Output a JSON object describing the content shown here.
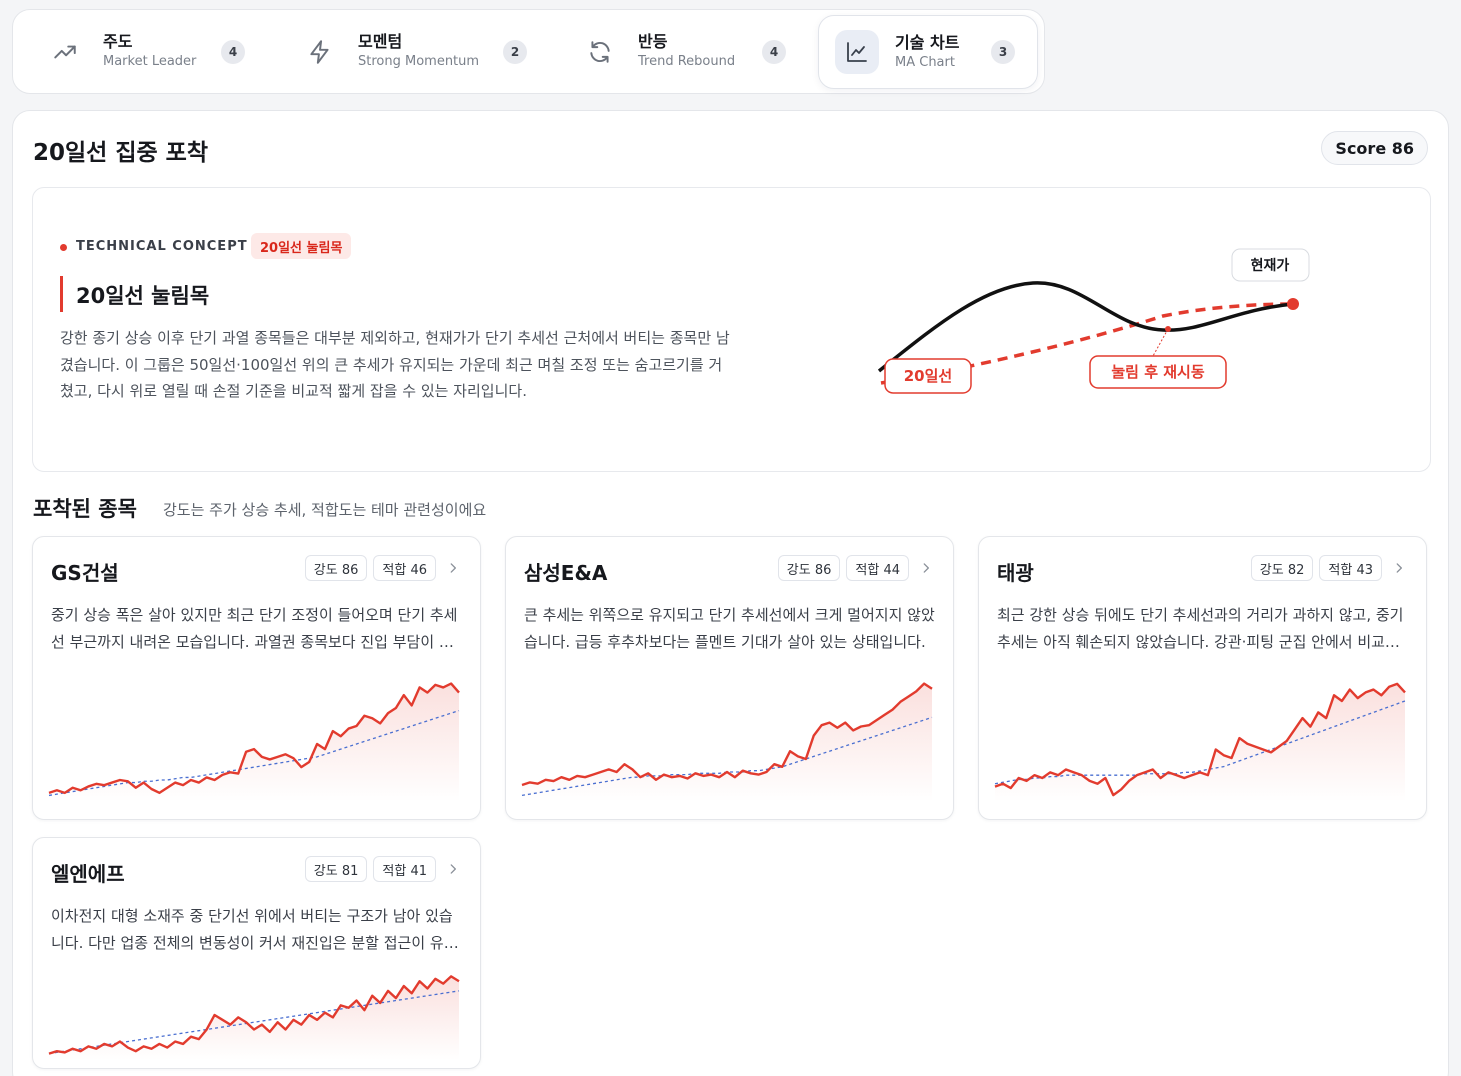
{
  "tabs": [
    {
      "title": "주도",
      "subtitle": "Market Leader",
      "count": "4",
      "icon": "trending-up-icon",
      "active": false
    },
    {
      "title": "모멘텀",
      "subtitle": "Strong Momentum",
      "count": "2",
      "icon": "lightning-icon",
      "active": false
    },
    {
      "title": "반등",
      "subtitle": "Trend Rebound",
      "count": "4",
      "icon": "refresh-icon",
      "active": false
    },
    {
      "title": "기술 차트",
      "subtitle": "MA Chart",
      "count": "3",
      "icon": "line-chart-icon",
      "active": true
    }
  ],
  "header": {
    "title": "20일선 집중 포착",
    "score": "Score 86"
  },
  "concept": {
    "tag": "TECHNICAL CONCEPT",
    "pill": "20일선 눌림목",
    "title": "20일선 눌림목",
    "description": "강한 종기 상승 이후 단기 과열 종목들은 대부분 제외하고, 현재가가 단기 추세선 근처에서 버티는 종목만 남겼습니다. 이 그룹은 50일선·100일선 위의 큰 추세가 유지되는 가운데 최근 며칠 조정 또는 숨고르기를 거쳤고, 다시 위로 열릴 때 손절 기준을 비교적 짧게 잡을 수 있는 자리입니다.",
    "diagram": {
      "price_label": "현재가",
      "ma_label": "20일선",
      "rebound_label": "눌림 후 재시동"
    }
  },
  "section": {
    "title": "포착된 종목",
    "subtitle": "강도는 주가 상승 추세, 적합도는 테마 관련성이에요"
  },
  "colors": {
    "accent": "#e23b2e",
    "ma_line": "#4a6fd1",
    "text": "#16181d"
  },
  "cards": [
    {
      "name": "GS건설",
      "strength": "강도 86",
      "fit": "적합 46",
      "description": "중기 상승 폭은 살아 있지만 최근 단기 조정이 들어오며 단기 추세선 부근까지 내려온 모습입니다. 과열권 종목보다 진입 부담이 상대적으로 적습니다.",
      "price": [
        10,
        12,
        10,
        14,
        12,
        15,
        17,
        16,
        18,
        20,
        19,
        14,
        18,
        13,
        10,
        14,
        18,
        16,
        20,
        18,
        22,
        20,
        24,
        26,
        25,
        42,
        44,
        38,
        36,
        38,
        40,
        37,
        30,
        34,
        48,
        44,
        58,
        54,
        60,
        62,
        70,
        68,
        64,
        72,
        76,
        86,
        78,
        92,
        88,
        94,
        92,
        95,
        88
      ],
      "ma": [
        8,
        9,
        10,
        11,
        12,
        13,
        14,
        15,
        16,
        17,
        18,
        18,
        19,
        19,
        20,
        20,
        21,
        22,
        22,
        23,
        24,
        25,
        26,
        27,
        28,
        29,
        30,
        31,
        32,
        33,
        34,
        35,
        36,
        37,
        38,
        40,
        42,
        44,
        46,
        48,
        50,
        52,
        54,
        56,
        58,
        60,
        62,
        64,
        66,
        68,
        70,
        72,
        74
      ]
    },
    {
      "name": "삼성E&A",
      "strength": "강도 86",
      "fit": "적합 44",
      "description": "큰 추세는 위쪽으로 유지되고 단기 추세선에서 크게 멀어지지 않았습니다. 급등 후추차보다는 플멘트 기대가 살아 있는 상태입니다.",
      "price": [
        18,
        20,
        19,
        22,
        21,
        24,
        22,
        25,
        24,
        26,
        28,
        30,
        28,
        34,
        30,
        24,
        27,
        22,
        26,
        24,
        25,
        23,
        27,
        25,
        26,
        24,
        28,
        24,
        29,
        27,
        26,
        28,
        34,
        32,
        44,
        40,
        38,
        56,
        64,
        66,
        62,
        66,
        60,
        63,
        64,
        68,
        72,
        76,
        82,
        86,
        90,
        96,
        92
      ],
      "ma": [
        10,
        11,
        12,
        13,
        14,
        15,
        16,
        17,
        18,
        19,
        20,
        21,
        22,
        23,
        24,
        24,
        25,
        25,
        25,
        26,
        26,
        26,
        27,
        27,
        27,
        27,
        28,
        28,
        28,
        29,
        29,
        30,
        31,
        32,
        34,
        36,
        38,
        40,
        42,
        44,
        46,
        48,
        50,
        52,
        54,
        56,
        58,
        60,
        62,
        64,
        66,
        68,
        70
      ]
    },
    {
      "name": "태광",
      "strength": "강도 82",
      "fit": "적합 43",
      "description": "최근 강한 상승 뒤에도 단기 추세선과의 거리가 과하지 않고, 중기 추세는 아직 훼손되지 않았습니다. 강관·피팅 군집 안에서 비교적 안정적인 흐름입니다.",
      "price": [
        14,
        16,
        13,
        20,
        18,
        22,
        20,
        24,
        22,
        26,
        24,
        22,
        18,
        16,
        20,
        8,
        12,
        18,
        22,
        24,
        26,
        20,
        24,
        22,
        20,
        22,
        24,
        22,
        40,
        36,
        34,
        48,
        44,
        42,
        40,
        38,
        42,
        46,
        54,
        62,
        56,
        66,
        62,
        78,
        74,
        82,
        76,
        80,
        82,
        78,
        84,
        86,
        80
      ],
      "ma": [
        16,
        17,
        18,
        19,
        19,
        20,
        20,
        21,
        21,
        22,
        22,
        22,
        22,
        22,
        22,
        22,
        22,
        22,
        22,
        23,
        23,
        23,
        23,
        23,
        24,
        24,
        25,
        26,
        27,
        28,
        30,
        32,
        34,
        36,
        38,
        40,
        42,
        44,
        46,
        48,
        50,
        52,
        54,
        56,
        58,
        60,
        62,
        64,
        66,
        68,
        70,
        72,
        74
      ]
    },
    {
      "name": "엘엔에프",
      "strength": "강도 81",
      "fit": "적합 41",
      "description": "이차전지 대형 소재주 중 단기선 위에서 버티는 구조가 남아 있습니다. 다만 업종 전체의 변동성이 커서 재진입은 분할 접근이 유리합니다.",
      "price": [
        10,
        12,
        11,
        14,
        12,
        16,
        14,
        18,
        16,
        20,
        15,
        12,
        16,
        14,
        18,
        15,
        20,
        18,
        24,
        22,
        30,
        42,
        38,
        34,
        40,
        36,
        30,
        34,
        28,
        36,
        30,
        38,
        34,
        42,
        38,
        44,
        40,
        50,
        48,
        54,
        46,
        58,
        52,
        62,
        56,
        66,
        60,
        70,
        64,
        72,
        68,
        74,
        70
      ],
      "ma": [
        10,
        11,
        12,
        13,
        14,
        15,
        16,
        17,
        18,
        19,
        20,
        21,
        22,
        23,
        24,
        25,
        26,
        27,
        28,
        29,
        30,
        31,
        32,
        33,
        34,
        35,
        36,
        37,
        38,
        39,
        40,
        41,
        42,
        43,
        44,
        45,
        46,
        47,
        48,
        49,
        50,
        51,
        52,
        53,
        54,
        55,
        56,
        57,
        58,
        59,
        60,
        61,
        62
      ]
    }
  ]
}
